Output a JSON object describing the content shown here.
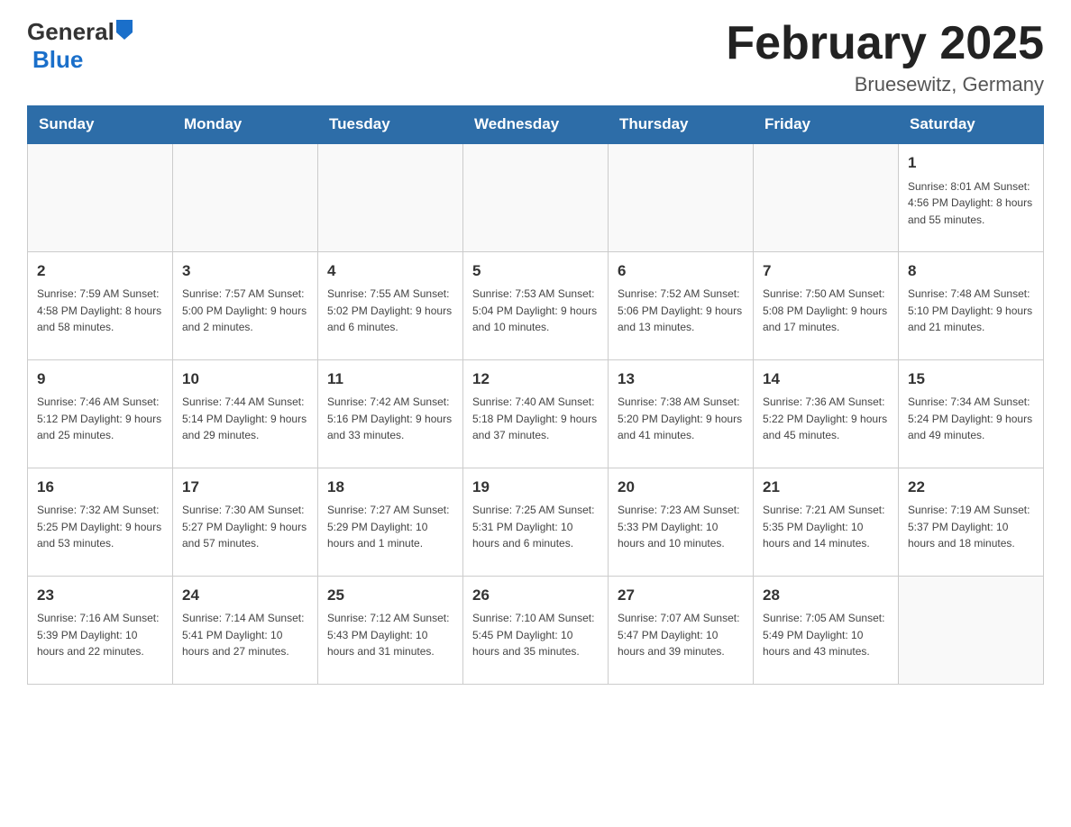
{
  "header": {
    "logo_general": "General",
    "logo_blue": "Blue",
    "title": "February 2025",
    "subtitle": "Bruesewitz, Germany"
  },
  "calendar": {
    "days_of_week": [
      "Sunday",
      "Monday",
      "Tuesday",
      "Wednesday",
      "Thursday",
      "Friday",
      "Saturday"
    ],
    "weeks": [
      [
        {
          "day": "",
          "info": ""
        },
        {
          "day": "",
          "info": ""
        },
        {
          "day": "",
          "info": ""
        },
        {
          "day": "",
          "info": ""
        },
        {
          "day": "",
          "info": ""
        },
        {
          "day": "",
          "info": ""
        },
        {
          "day": "1",
          "info": "Sunrise: 8:01 AM\nSunset: 4:56 PM\nDaylight: 8 hours and 55 minutes."
        }
      ],
      [
        {
          "day": "2",
          "info": "Sunrise: 7:59 AM\nSunset: 4:58 PM\nDaylight: 8 hours and 58 minutes."
        },
        {
          "day": "3",
          "info": "Sunrise: 7:57 AM\nSunset: 5:00 PM\nDaylight: 9 hours and 2 minutes."
        },
        {
          "day": "4",
          "info": "Sunrise: 7:55 AM\nSunset: 5:02 PM\nDaylight: 9 hours and 6 minutes."
        },
        {
          "day": "5",
          "info": "Sunrise: 7:53 AM\nSunset: 5:04 PM\nDaylight: 9 hours and 10 minutes."
        },
        {
          "day": "6",
          "info": "Sunrise: 7:52 AM\nSunset: 5:06 PM\nDaylight: 9 hours and 13 minutes."
        },
        {
          "day": "7",
          "info": "Sunrise: 7:50 AM\nSunset: 5:08 PM\nDaylight: 9 hours and 17 minutes."
        },
        {
          "day": "8",
          "info": "Sunrise: 7:48 AM\nSunset: 5:10 PM\nDaylight: 9 hours and 21 minutes."
        }
      ],
      [
        {
          "day": "9",
          "info": "Sunrise: 7:46 AM\nSunset: 5:12 PM\nDaylight: 9 hours and 25 minutes."
        },
        {
          "day": "10",
          "info": "Sunrise: 7:44 AM\nSunset: 5:14 PM\nDaylight: 9 hours and 29 minutes."
        },
        {
          "day": "11",
          "info": "Sunrise: 7:42 AM\nSunset: 5:16 PM\nDaylight: 9 hours and 33 minutes."
        },
        {
          "day": "12",
          "info": "Sunrise: 7:40 AM\nSunset: 5:18 PM\nDaylight: 9 hours and 37 minutes."
        },
        {
          "day": "13",
          "info": "Sunrise: 7:38 AM\nSunset: 5:20 PM\nDaylight: 9 hours and 41 minutes."
        },
        {
          "day": "14",
          "info": "Sunrise: 7:36 AM\nSunset: 5:22 PM\nDaylight: 9 hours and 45 minutes."
        },
        {
          "day": "15",
          "info": "Sunrise: 7:34 AM\nSunset: 5:24 PM\nDaylight: 9 hours and 49 minutes."
        }
      ],
      [
        {
          "day": "16",
          "info": "Sunrise: 7:32 AM\nSunset: 5:25 PM\nDaylight: 9 hours and 53 minutes."
        },
        {
          "day": "17",
          "info": "Sunrise: 7:30 AM\nSunset: 5:27 PM\nDaylight: 9 hours and 57 minutes."
        },
        {
          "day": "18",
          "info": "Sunrise: 7:27 AM\nSunset: 5:29 PM\nDaylight: 10 hours and 1 minute."
        },
        {
          "day": "19",
          "info": "Sunrise: 7:25 AM\nSunset: 5:31 PM\nDaylight: 10 hours and 6 minutes."
        },
        {
          "day": "20",
          "info": "Sunrise: 7:23 AM\nSunset: 5:33 PM\nDaylight: 10 hours and 10 minutes."
        },
        {
          "day": "21",
          "info": "Sunrise: 7:21 AM\nSunset: 5:35 PM\nDaylight: 10 hours and 14 minutes."
        },
        {
          "day": "22",
          "info": "Sunrise: 7:19 AM\nSunset: 5:37 PM\nDaylight: 10 hours and 18 minutes."
        }
      ],
      [
        {
          "day": "23",
          "info": "Sunrise: 7:16 AM\nSunset: 5:39 PM\nDaylight: 10 hours and 22 minutes."
        },
        {
          "day": "24",
          "info": "Sunrise: 7:14 AM\nSunset: 5:41 PM\nDaylight: 10 hours and 27 minutes."
        },
        {
          "day": "25",
          "info": "Sunrise: 7:12 AM\nSunset: 5:43 PM\nDaylight: 10 hours and 31 minutes."
        },
        {
          "day": "26",
          "info": "Sunrise: 7:10 AM\nSunset: 5:45 PM\nDaylight: 10 hours and 35 minutes."
        },
        {
          "day": "27",
          "info": "Sunrise: 7:07 AM\nSunset: 5:47 PM\nDaylight: 10 hours and 39 minutes."
        },
        {
          "day": "28",
          "info": "Sunrise: 7:05 AM\nSunset: 5:49 PM\nDaylight: 10 hours and 43 minutes."
        },
        {
          "day": "",
          "info": ""
        }
      ]
    ]
  }
}
